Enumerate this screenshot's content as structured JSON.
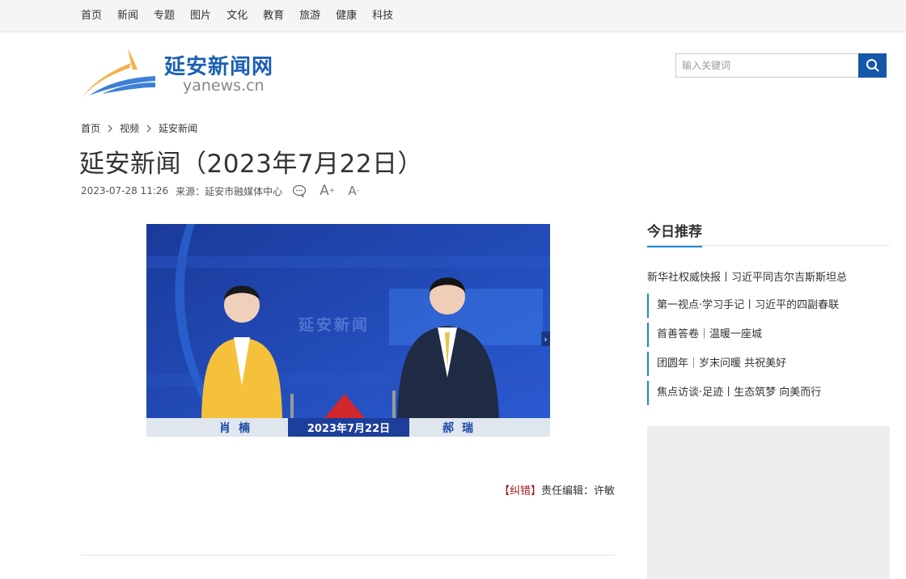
{
  "nav": {
    "items": [
      "首页",
      "新闻",
      "专题",
      "图片",
      "文化",
      "教育",
      "旅游",
      "健康",
      "科技"
    ]
  },
  "logo": {
    "title": "延安新闻网",
    "subtitle": "yanews.cn"
  },
  "search": {
    "placeholder": "输入关键词"
  },
  "breadcrumb": [
    "首页",
    "视频",
    "延安新闻"
  ],
  "article": {
    "title": "延安新闻（2023年7月22日）",
    "datetime": "2023-07-28 11:26",
    "source": "来源：延安市融媒体中心",
    "font_up": "A",
    "font_down": "A"
  },
  "video": {
    "anchor_left": "肖楠",
    "anchor_right": "郝瑞",
    "date": "2023年7月22日",
    "station": "延安新闻"
  },
  "editor": {
    "correction": "【纠错】",
    "label": "责任编辑：许敏"
  },
  "sidebar": {
    "heading": "今日推荐",
    "first": "新华社权威快报丨习近平同吉尔吉斯斯坦总",
    "items": [
      "第一视点·学习手记丨习近平的四副春联",
      "首善答卷｜温暖一座城",
      "团圆年｜岁末问暖 共祝美好",
      "焦点访谈·足迹丨生态筑梦 向美而行"
    ]
  },
  "colors": {
    "brand_blue": "#1557a8",
    "accent": "#1a8ad1",
    "correction_red": "#a0171f"
  }
}
